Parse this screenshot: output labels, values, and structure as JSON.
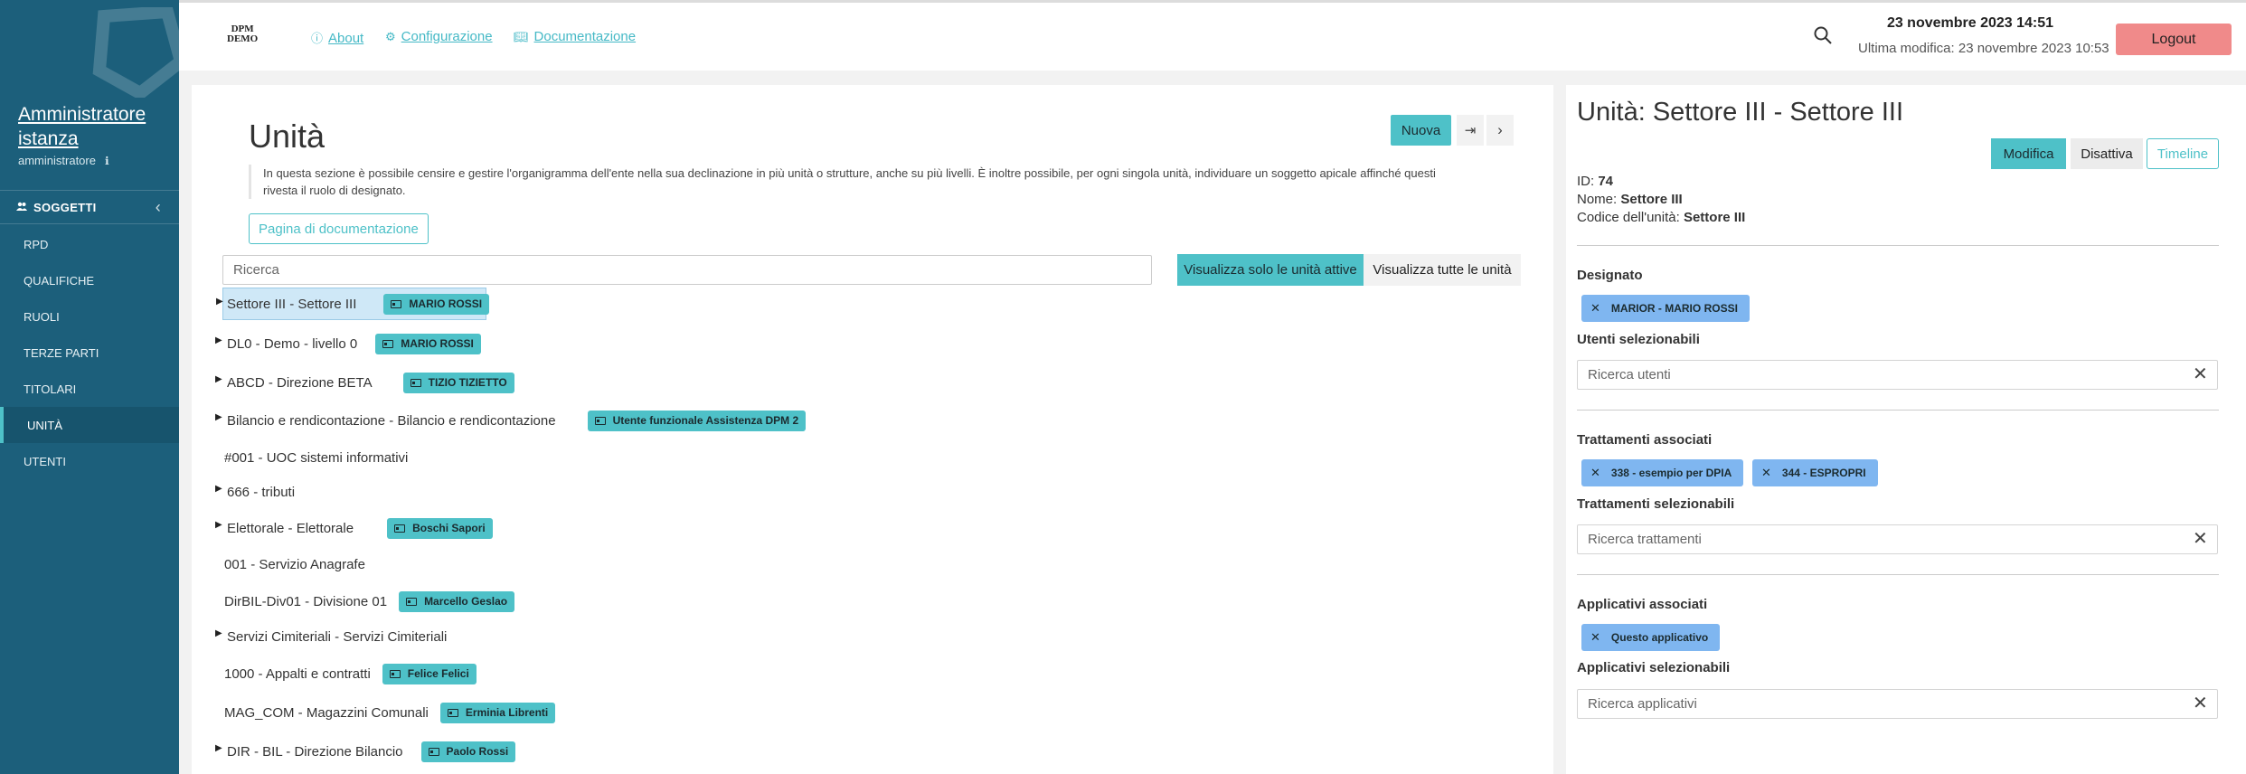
{
  "sidebar": {
    "user_name": "Amministratore istanza",
    "user_role": "amministratore",
    "section_label": "SOGGETTI",
    "items": [
      {
        "label": "RPD",
        "active": false
      },
      {
        "label": "QUALIFICHE",
        "active": false
      },
      {
        "label": "RUOLI",
        "active": false
      },
      {
        "label": "TERZE PARTI",
        "active": false
      },
      {
        "label": "TITOLARI",
        "active": false
      },
      {
        "label": "UNITÀ",
        "active": true
      },
      {
        "label": "UTENTI",
        "active": false
      }
    ]
  },
  "header": {
    "brand_line1": "DPM",
    "brand_line2": "DEMO",
    "links": [
      {
        "label": "About",
        "icon": "info-icon"
      },
      {
        "label": "Configurazione",
        "icon": "gear-icon"
      },
      {
        "label": "Documentazione",
        "icon": "book-icon"
      }
    ],
    "datetime": "23 novembre 2023 14:51",
    "last_modified": "Ultima modifica: 23 novembre 2023 10:53",
    "logout_label": "Logout"
  },
  "main": {
    "title": "Unità",
    "new_label": "Nuova",
    "description": "In questa sezione è possibile censire e gestire l'organigramma dell'ente nella sua declinazione in più unità o strutture, anche su più livelli. È inoltre possibile, per ogni singola unità, individuare un soggetto apicale affinché questi rivesta il ruolo di designato.",
    "docs_button": "Pagina di documentazione",
    "search_placeholder": "Ricerca",
    "filter_active_label": "Visualizza solo le unità attive",
    "filter_all_label": "Visualizza tutte le unità",
    "tree": [
      {
        "label": "Settore III - Settore III",
        "badge": "MARIO ROSSI",
        "has_children": true,
        "selected": true
      },
      {
        "label": "DL0 - Demo - livello 0",
        "badge": "MARIO ROSSI",
        "has_children": true,
        "selected": false
      },
      {
        "label": "ABCD - Direzione BETA",
        "badge": "TIZIO TIZIETTO",
        "has_children": true,
        "selected": false
      },
      {
        "label": "Bilancio e rendicontazione - Bilancio e rendicontazione",
        "badge": "Utente funzionale Assistenza DPM 2",
        "has_children": true,
        "selected": false
      },
      {
        "label": "#001 - UOC sistemi informativi",
        "badge": null,
        "has_children": false,
        "selected": false
      },
      {
        "label": "666 - tributi",
        "badge": null,
        "has_children": true,
        "selected": false
      },
      {
        "label": "Elettorale - Elettorale",
        "badge": "Boschi Sapori",
        "has_children": true,
        "selected": false
      },
      {
        "label": "001 - Servizio Anagrafe",
        "badge": null,
        "has_children": false,
        "selected": false
      },
      {
        "label": "DirBIL-Div01 - Divisione 01",
        "badge": "Marcello Geslao",
        "has_children": false,
        "selected": false
      },
      {
        "label": "Servizi Cimiteriali - Servizi Cimiteriali",
        "badge": null,
        "has_children": true,
        "selected": false
      },
      {
        "label": "1000 - Appalti e contratti",
        "badge": "Felice Felici",
        "has_children": false,
        "selected": false
      },
      {
        "label": "MAG_COM - Magazzini Comunali",
        "badge": "Erminia Librenti",
        "has_children": false,
        "selected": false
      },
      {
        "label": "DIR - BIL - Direzione Bilancio",
        "badge": "Paolo Rossi",
        "has_children": true,
        "selected": false
      }
    ]
  },
  "detail": {
    "title": "Unità: Settore III - Settore III",
    "edit_label": "Modifica",
    "disable_label": "Disattiva",
    "timeline_label": "Timeline",
    "id_label": "ID:",
    "id_value": "74",
    "name_label": "Nome:",
    "name_value": "Settore III",
    "code_label": "Codice dell'unità:",
    "code_value": "Settore III",
    "designato_title": "Designato",
    "designato_chip": "MARIOR - MARIO ROSSI",
    "utenti_title": "Utenti selezionabili",
    "utenti_placeholder": "Ricerca utenti",
    "trattamenti_title": "Trattamenti associati",
    "trattamenti_chips": [
      "338 - esempio per DPIA",
      "344 - ESPROPRI"
    ],
    "trattamenti_sel_title": "Trattamenti selezionabili",
    "trattamenti_placeholder": "Ricerca trattamenti",
    "applicativi_title": "Applicativi associati",
    "applicativi_chip": "Questo applicativo",
    "applicativi_sel_title": "Applicativi selezionabili",
    "applicativi_placeholder": "Ricerca applicativi"
  },
  "colors": {
    "sidebar": "#1c5f7b",
    "accent": "#4ec1c8",
    "chip": "#7fb6f0",
    "logout": "#f08a8a"
  }
}
